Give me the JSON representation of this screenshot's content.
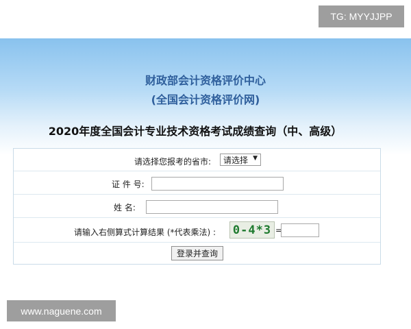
{
  "watermarks": {
    "top": "TG: MYYJJPP",
    "bottom": "www.naguene.com"
  },
  "header": {
    "org_title": "财政部会计资格评价中心",
    "org_subtitle": "(全国会计资格评价网)",
    "query_title": "2020年度全国会计专业技术资格考试成绩查询（中、高级）"
  },
  "form": {
    "province_label": "请选择您报考的省市:",
    "province_select_value": "请选择",
    "id_label": "证 件 号:",
    "id_value": "",
    "name_label": "姓    名:",
    "name_value": "",
    "captcha_label": "请输入右侧算式计算结果 (*代表乘法) :",
    "captcha_text": "0-4*3",
    "equals_sign": "=",
    "captcha_value": "",
    "submit_label": "登录并查询"
  },
  "colors": {
    "banner_top": "#89c2ee",
    "title_blue": "#2f5f9c",
    "captcha_green": "#1e7a2e"
  }
}
